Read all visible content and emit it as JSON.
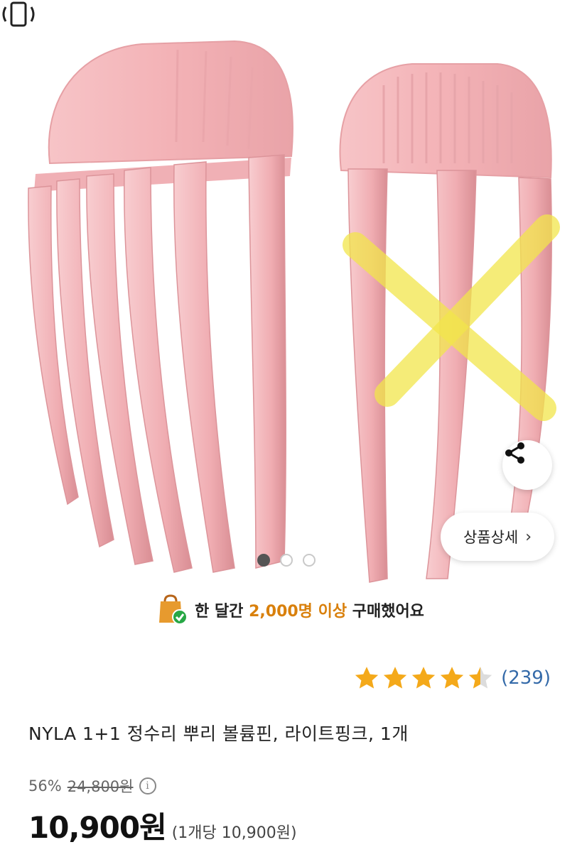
{
  "product_image": {
    "description_icon": "hair-volume-pin-photo",
    "dots_total": 3,
    "dots_active_index": 0
  },
  "buttons": {
    "share_icon": "share-icon",
    "detail_label": "상품상세",
    "detail_chevron": "›"
  },
  "purchase_notice": {
    "prefix": "한 달간 ",
    "highlight": "2,000명 이상",
    "suffix": " 구매했어요",
    "icon": "shopping-bag-check-icon",
    "highlight_color": "#d9800c"
  },
  "rating": {
    "stars": 4.5,
    "count": "(239)",
    "star_color": "#f4a91a"
  },
  "product": {
    "title": "NYLA 1+1 정수리 뿌리 볼륨핀, 라이트핑크, 1개",
    "discount": "56%",
    "original_price": "24,800원",
    "price": "10,900원",
    "unit_price": "(1개당 10,900원)"
  }
}
